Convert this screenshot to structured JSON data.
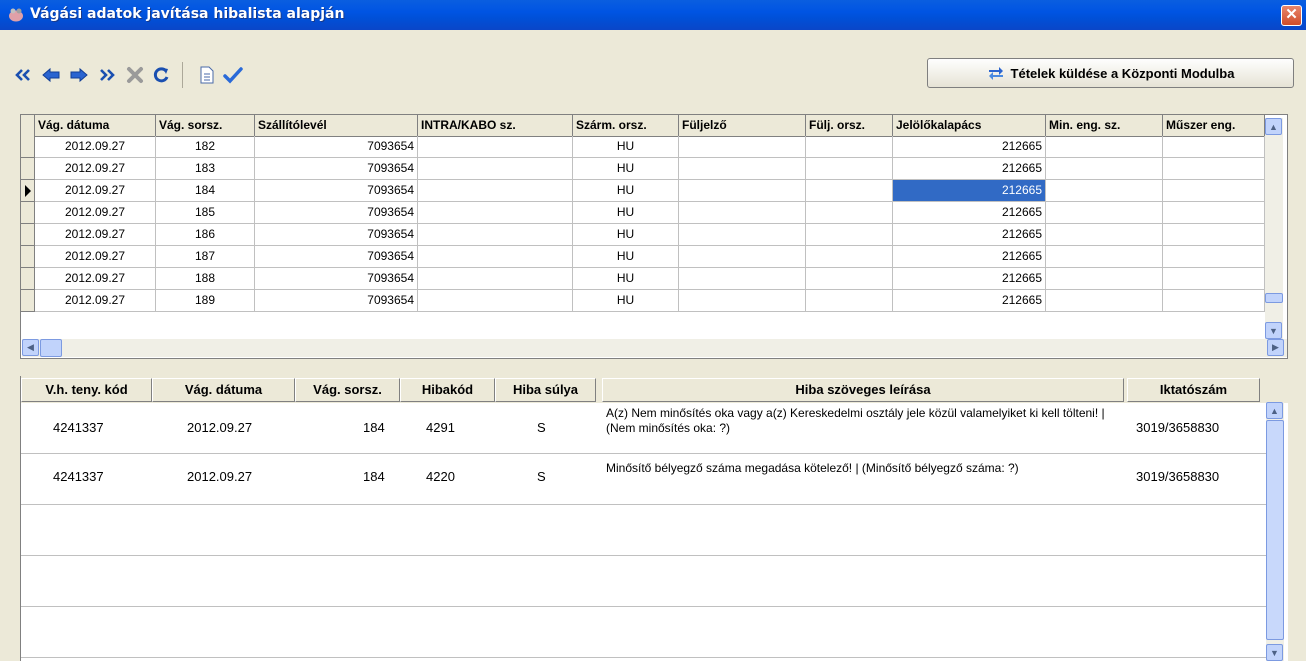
{
  "window": {
    "title": "Vágási adatok javítása hibalista alapján",
    "close_glyph": "✕"
  },
  "toolbar": {
    "buttons": [
      {
        "name": "first-record-button",
        "icon": "double-left-arrow-icon"
      },
      {
        "name": "previous-record-button",
        "icon": "left-arrow-icon"
      },
      {
        "name": "next-record-button",
        "icon": "right-arrow-icon"
      },
      {
        "name": "last-record-button",
        "icon": "double-right-arrow-icon"
      },
      {
        "name": "delete-button",
        "icon": "x-icon"
      },
      {
        "name": "refresh-button",
        "icon": "refresh-icon"
      },
      {
        "name": "document-button",
        "icon": "document-icon"
      },
      {
        "name": "confirm-button",
        "icon": "checkmark-icon"
      }
    ],
    "send_label": "Tételek küldése a Központi Modulba"
  },
  "upper_grid": {
    "columns": [
      "Vág. dátuma",
      "Vág. sorsz.",
      "Szállítólevél",
      "INTRA/KABO sz.",
      "Szárm. orsz.",
      "Füljelző",
      "Fülj. orsz.",
      "Jelölőkalapács",
      "Min. eng. sz.",
      "Műszer eng."
    ],
    "rows": [
      [
        "2012.09.27",
        "182",
        "7093654",
        "",
        "HU",
        "",
        "",
        "212665",
        "",
        ""
      ],
      [
        "2012.09.27",
        "183",
        "7093654",
        "",
        "HU",
        "",
        "",
        "212665",
        "",
        ""
      ],
      [
        "2012.09.27",
        "184",
        "7093654",
        "",
        "HU",
        "",
        "",
        "212665",
        "",
        ""
      ],
      [
        "2012.09.27",
        "185",
        "7093654",
        "",
        "HU",
        "",
        "",
        "212665",
        "",
        ""
      ],
      [
        "2012.09.27",
        "186",
        "7093654",
        "",
        "HU",
        "",
        "",
        "212665",
        "",
        ""
      ],
      [
        "2012.09.27",
        "187",
        "7093654",
        "",
        "HU",
        "",
        "",
        "212665",
        "",
        ""
      ],
      [
        "2012.09.27",
        "188",
        "7093654",
        "",
        "HU",
        "",
        "",
        "212665",
        "",
        ""
      ],
      [
        "2012.09.27",
        "189",
        "7093654",
        "",
        "HU",
        "",
        "",
        "212665",
        "",
        ""
      ]
    ],
    "current_row": 2,
    "selected_column": 7
  },
  "lower_grid": {
    "columns": [
      "V.h. teny. kód",
      "Vág. dátuma",
      "Vág. sorsz.",
      "Hibakód",
      "Hiba súlya",
      "Hiba szöveges leírása",
      "Iktatószám"
    ],
    "rows": [
      {
        "code": "4241337",
        "date": "2012.09.27",
        "seq": "184",
        "error_code": "4291",
        "severity": "S",
        "description": "A(z) Nem minősítés oka vagy a(z) Kereskedelmi osztály jele közül valamelyiket ki kell tölteni! | (Nem minősítés oka: ?)",
        "reg_no": "3019/3658830"
      },
      {
        "code": "4241337",
        "date": "2012.09.27",
        "seq": "184",
        "error_code": "4220",
        "severity": "S",
        "description": "Minősítő bélyegző száma megadása kötelező! | (Minősítő bélyegző száma: ?)",
        "reg_no": "3019/3658830"
      }
    ]
  }
}
